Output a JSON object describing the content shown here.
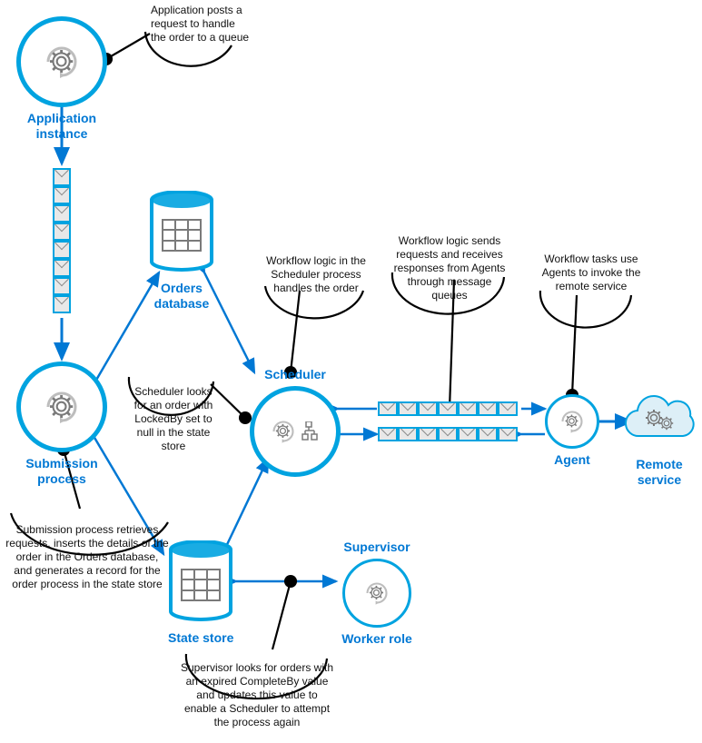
{
  "nodes": {
    "app_instance": {
      "label": "Application\ninstance"
    },
    "submission_process": {
      "label": "Submission\nprocess"
    },
    "orders_db": {
      "label": "Orders\ndatabase"
    },
    "state_store": {
      "label": "State store"
    },
    "scheduler": {
      "label": "Scheduler"
    },
    "agent": {
      "label": "Agent"
    },
    "supervisor": {
      "label": "Supervisor"
    },
    "worker_role": {
      "label": "Worker role"
    },
    "remote_service": {
      "label": "Remote\nservice"
    }
  },
  "notes": {
    "app_instance": "Application posts a request to handle the order to a queue",
    "submission_process": "Submission process retrieves requests, inserts the details of the order in the Orders database, and generates a record for the order process in the state store",
    "scheduler_lookup": "Scheduler looks for an order with LockedBy set to null in the state store",
    "scheduler_workflow": "Workflow logic in the Scheduler process handles the order",
    "agent_queue": "Workflow logic sends requests and receives responses from Agents through message queues",
    "agent_tasks": "Workflow tasks use Agents to invoke the remote service",
    "supervisor": "Supervisor looks for orders with an expired CompleteBy value and updates this value to enable a Scheduler to attempt the process again"
  },
  "colors": {
    "accent": "#00A3E0",
    "label": "#0078D4",
    "icon": "#7A7A7A",
    "note_line": "#000000"
  }
}
